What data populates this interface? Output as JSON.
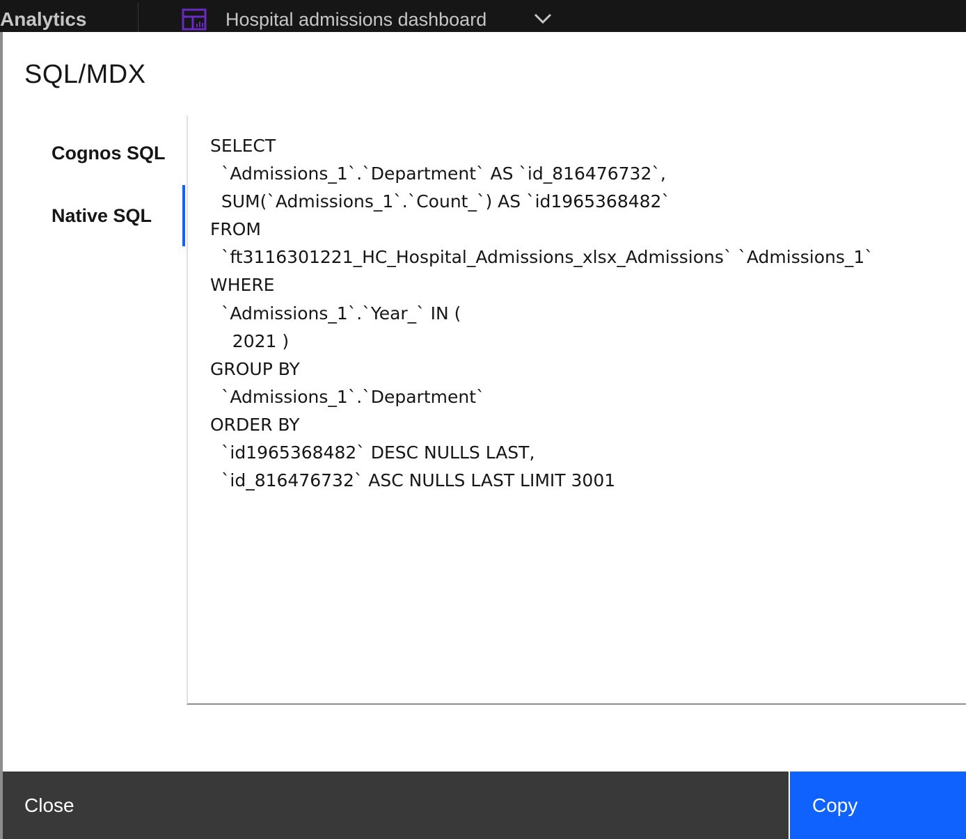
{
  "topbar": {
    "brand": "Analytics",
    "dashboard_icon": "dashboard-icon",
    "dashboard_title": "Hospital admissions dashboard",
    "chevron_icon": "chevron-down-icon"
  },
  "modal": {
    "title": "SQL/MDX",
    "tabs": [
      {
        "label": "Cognos SQL",
        "active": false
      },
      {
        "label": "Native SQL",
        "active": true
      }
    ],
    "code": "SELECT\n  `Admissions_1`.`Department` AS `id_816476732`,\n  SUM(`Admissions_1`.`Count_`) AS `id1965368482`\nFROM\n  `ft3116301221_HC_Hospital_Admissions_xlsx_Admissions` `Admissions_1`\nWHERE\n  `Admissions_1`.`Year_` IN (\n    2021 )\nGROUP BY\n  `Admissions_1`.`Department`\nORDER BY\n  `id1965368482` DESC NULLS LAST,\n  `id_816476732` ASC NULLS LAST LIMIT 3001",
    "close_label": "Close",
    "copy_label": "Copy"
  },
  "colors": {
    "accent": "#0f62fe",
    "topbar_bg": "#161616",
    "close_bg": "#393939",
    "icon_purple": "#6929c4"
  }
}
